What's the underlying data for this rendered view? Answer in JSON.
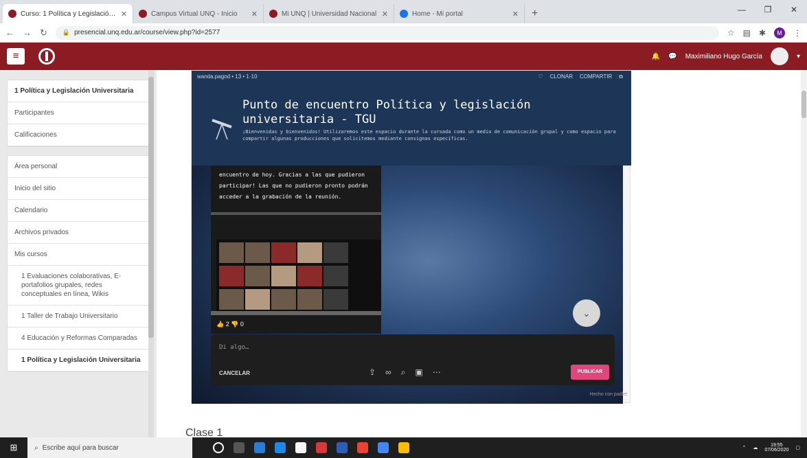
{
  "browser": {
    "tabs": [
      {
        "title": "Curso: 1 Política y Legislación Un..."
      },
      {
        "title": "Campus Virtual UNQ - Inicio"
      },
      {
        "title": "Mi UNQ | Universidad Nacional"
      },
      {
        "title": "Home - Mi portal"
      }
    ],
    "new_tab": "+",
    "url": "presencial.unq.edu.ar/course/view.php?id=2577"
  },
  "appbar": {
    "user": "Maximiliano Hugo García"
  },
  "sidebar": {
    "course_box": [
      "1 Política y Legislación Universitaria",
      "Participantes",
      "Calificaciones"
    ],
    "nav_box": [
      "Área personal",
      "Inicio del sitio",
      "Calendario",
      "Archivos privados",
      "Mis cursos",
      "1 Evaluaciones colaborativas, E-portafolios grupales, redes conceptuales en línea, Wikis",
      "1 Taller de Trabajo Universitario",
      "4 Educación y Reformas Comparadas",
      "1 Política y Legislación Universitaria"
    ]
  },
  "padlet": {
    "top_left": "wanda.pagod • 13 • 1·10",
    "top_actions": [
      "♡",
      "CLONAR",
      "COMPARTIR"
    ],
    "title": "Punto de encuentro Política y legislación universitaria - TGU",
    "description": "¡Bienvenidas y bienvenidos! Utilizaremos este espacio durante la cursada como un medio de comunicación grupal y como espacio para compartir algunas producciones que solicitemos mediante consignas específicas.",
    "card_text": "encuentro de hoy. Gracias a las que pudieron participar! Las que no pudieron pronto podrán acceder a la grabación de la reunión.",
    "reactions": "👍 2  👎 0",
    "composer_placeholder": "Di algo…",
    "cancel_label": "CANCELAR",
    "publish_label": "PUBLICAR",
    "footer": "Hecho con padlet"
  },
  "main": {
    "section_title": "Clase 1"
  },
  "taskbar": {
    "search_placeholder": "Escribe aquí para buscar",
    "time": "19:55",
    "date": "07/06/2020"
  }
}
